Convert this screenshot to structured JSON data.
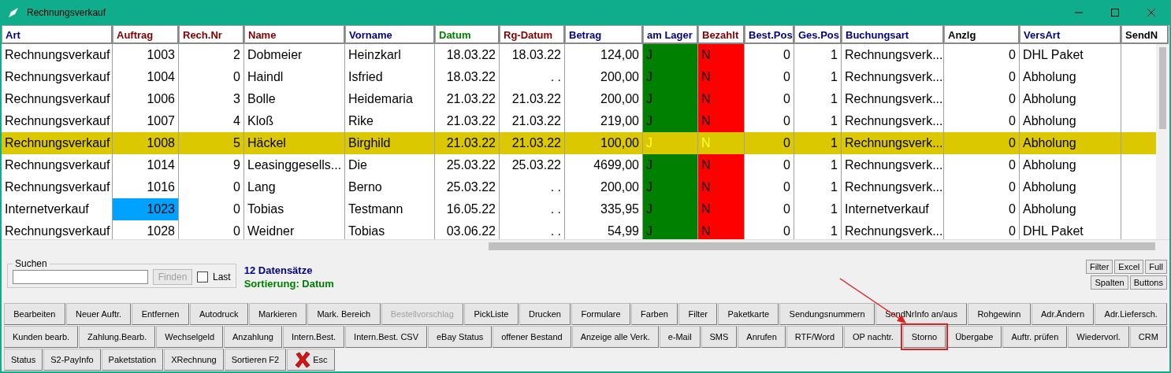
{
  "window": {
    "title": "Rechnungsverkauf"
  },
  "table": {
    "columns": [
      {
        "label": "Art",
        "color": "#000080",
        "kind": "text"
      },
      {
        "label": "Auftrag",
        "color": "#800000",
        "kind": "text"
      },
      {
        "label": "Rech.Nr",
        "color": "#800000",
        "kind": "text"
      },
      {
        "label": "Name",
        "color": "#800000",
        "kind": "text"
      },
      {
        "label": "Vorname",
        "color": "#000080",
        "kind": "text"
      },
      {
        "label": "Datum",
        "color": "#008000",
        "kind": "text"
      },
      {
        "label": "Rg-Datum",
        "color": "#800000",
        "kind": "text"
      },
      {
        "label": "Betrag",
        "color": "#000080",
        "kind": "text"
      },
      {
        "label": "am Lager",
        "color": "#000080",
        "kind": "stock"
      },
      {
        "label": "Bezahlt",
        "color": "#800000",
        "kind": "payment"
      },
      {
        "label": "Best.Pos",
        "color": "#000080",
        "kind": "text"
      },
      {
        "label": "Ges.Pos",
        "color": "#000080",
        "kind": "text"
      },
      {
        "label": "Buchungsart",
        "color": "#000080",
        "kind": "text"
      },
      {
        "label": "Anzlg",
        "color": "#000000",
        "kind": "text"
      },
      {
        "label": "VersArt",
        "color": "#000080",
        "kind": "text"
      },
      {
        "label": "SendN",
        "color": "#000000"
      }
    ],
    "rows": [
      {
        "selected": false,
        "cells": [
          "Rechnungsverkauf",
          "1003",
          "2",
          "Dobmeier",
          "Heinzkarl",
          "18.03.22",
          "18.03.22",
          "124,00",
          "J",
          "N",
          "0",
          "1",
          "Rechnungsverk...",
          "0",
          "DHL Paket"
        ]
      },
      {
        "selected": false,
        "cells": [
          "Rechnungsverkauf",
          "1004",
          "0",
          "Haindl",
          "Isfried",
          "18.03.22",
          ". .",
          "200,00",
          "J",
          "N",
          "0",
          "1",
          "Rechnungsverk...",
          "0",
          "Abholung"
        ]
      },
      {
        "selected": false,
        "cells": [
          "Rechnungsverkauf",
          "1006",
          "3",
          "Bolle",
          "Heidemaria",
          "21.03.22",
          "21.03.22",
          "200,00",
          "J",
          "N",
          "0",
          "1",
          "Rechnungsverk...",
          "0",
          "Abholung"
        ]
      },
      {
        "selected": false,
        "cells": [
          "Rechnungsverkauf",
          "1007",
          "4",
          "Kloß",
          "Rike",
          "21.03.22",
          "21.03.22",
          "219,00",
          "J",
          "N",
          "0",
          "1",
          "Rechnungsverk...",
          "0",
          "Abholung"
        ]
      },
      {
        "selected": true,
        "cells": [
          "Rechnungsverkauf",
          "1008",
          "5",
          "Häckel",
          "Birghild",
          "21.03.22",
          "21.03.22",
          "100,00",
          "J",
          "N",
          "0",
          "1",
          "Rechnungsverk...",
          "0",
          "Abholung"
        ]
      },
      {
        "selected": false,
        "cells": [
          "Rechnungsverkauf",
          "1014",
          "9",
          "Leasinggesells...",
          "Die",
          "25.03.22",
          "25.03.22",
          "4699,00",
          "J",
          "N",
          "0",
          "1",
          "Rechnungsverk...",
          "0",
          "Abholung"
        ]
      },
      {
        "selected": false,
        "cells": [
          "Rechnungsverkauf",
          "1016",
          "0",
          "Lang",
          "Berno",
          "25.03.22",
          ". .",
          "200,00",
          "J",
          "N",
          "0",
          "1",
          "Rechnungsverk...",
          "0",
          "Abholung"
        ]
      },
      {
        "selected": false,
        "cells": [
          "Internetverkauf",
          {
            "text": "1023",
            "focused": true
          },
          "0",
          "Tobias",
          "Testmann",
          "16.05.22",
          ". .",
          "335,95",
          "J",
          "N",
          "0",
          "1",
          "Internetverkauf",
          "0",
          "Abholung"
        ]
      },
      {
        "selected": false,
        "cells": [
          "Rechnungsverkauf",
          "1028",
          "0",
          "Weidner",
          "Tobias",
          "03.06.22",
          ". .",
          "54,99",
          "J",
          "N",
          "0",
          "1",
          "Rechnungsverk...",
          "0",
          "DHL Paket"
        ]
      }
    ]
  },
  "search": {
    "legend": "Suchen",
    "button": {
      "label": "Finden",
      "disabled": true
    },
    "last": {
      "label": "Last",
      "checked": false
    }
  },
  "info": {
    "count": "12 Datensätze",
    "sorting": "Sortierung: Datum"
  },
  "view_buttons": [
    [
      "Filter",
      "Excel",
      "Full"
    ],
    [
      "Spalten",
      "Buttons"
    ]
  ],
  "button_rows": [
    [
      {
        "label": "Bearbeiten",
        "disabled": false,
        "marked": false
      },
      {
        "label": "Neuer Auftr.",
        "disabled": false,
        "marked": false
      },
      {
        "label": "Entfernen",
        "disabled": false,
        "marked": false
      },
      {
        "label": "Autodruck",
        "disabled": false,
        "marked": false
      },
      {
        "label": "Markieren",
        "disabled": false,
        "marked": false
      },
      {
        "label": "Mark. Bereich",
        "disabled": false,
        "marked": false
      },
      {
        "label": "Bestellvorschlag",
        "disabled": true,
        "marked": false
      },
      {
        "label": "PickListe",
        "disabled": false,
        "marked": false
      },
      {
        "label": "Drucken",
        "disabled": false,
        "marked": false
      },
      {
        "label": "Formulare",
        "disabled": false,
        "marked": false
      },
      {
        "label": "Farben",
        "disabled": false,
        "marked": false
      },
      {
        "label": "Filter",
        "disabled": false,
        "marked": false
      },
      {
        "label": "Paketkarte",
        "disabled": false,
        "marked": false
      },
      {
        "label": "Sendungsnummern",
        "disabled": false,
        "marked": false
      },
      {
        "label": "SendNrInfo an/aus",
        "disabled": false,
        "marked": false
      },
      {
        "label": "Rohgewinn",
        "disabled": false,
        "marked": false
      },
      {
        "label": "Adr.Ändern",
        "disabled": false,
        "marked": false
      },
      {
        "label": "Adr.Liefersch.",
        "disabled": false,
        "marked": false
      }
    ],
    [
      {
        "label": "Kunden bearb.",
        "disabled": false,
        "marked": false
      },
      {
        "label": "Zahlung.Bearb.",
        "disabled": false,
        "marked": false
      },
      {
        "label": "Wechselgeld",
        "disabled": false,
        "marked": false
      },
      {
        "label": "Anzahlung",
        "disabled": false,
        "marked": false
      },
      {
        "label": "Intern.Best.",
        "disabled": false,
        "marked": false
      },
      {
        "label": "Intern.Best. CSV",
        "disabled": false,
        "marked": false
      },
      {
        "label": "eBay Status",
        "disabled": false,
        "marked": false
      },
      {
        "label": "offener Bestand",
        "disabled": false,
        "marked": false
      },
      {
        "label": "Anzeige alle Verk.",
        "disabled": false,
        "marked": false
      },
      {
        "label": "e-Mail",
        "disabled": false,
        "marked": false
      },
      {
        "label": "SMS",
        "disabled": false,
        "marked": false
      },
      {
        "label": "Anrufen",
        "disabled": false,
        "marked": false
      },
      {
        "label": "RTF/Word",
        "disabled": false,
        "marked": false
      },
      {
        "label": "OP nachtr.",
        "disabled": false,
        "marked": false
      },
      {
        "label": "Storno",
        "disabled": false,
        "marked": true
      },
      {
        "label": "Übergabe",
        "disabled": false,
        "marked": false
      },
      {
        "label": "Auftr. prüfen",
        "disabled": false,
        "marked": false
      },
      {
        "label": "Wiedervorl.",
        "disabled": false,
        "marked": false
      },
      {
        "label": "CRM",
        "disabled": false,
        "marked": false
      }
    ],
    [
      {
        "label": "Status",
        "disabled": false,
        "marked": false
      },
      {
        "label": "S2-PayInfo",
        "disabled": false,
        "marked": false
      },
      {
        "label": "Paketstation",
        "disabled": false,
        "marked": false
      },
      {
        "label": "XRechnung",
        "disabled": false,
        "marked": false
      },
      {
        "label": "Sortieren F2",
        "disabled": false,
        "marked": false
      },
      {
        "label": "Esc",
        "kind": "cancel",
        "disabled": false,
        "marked": false
      }
    ]
  ]
}
